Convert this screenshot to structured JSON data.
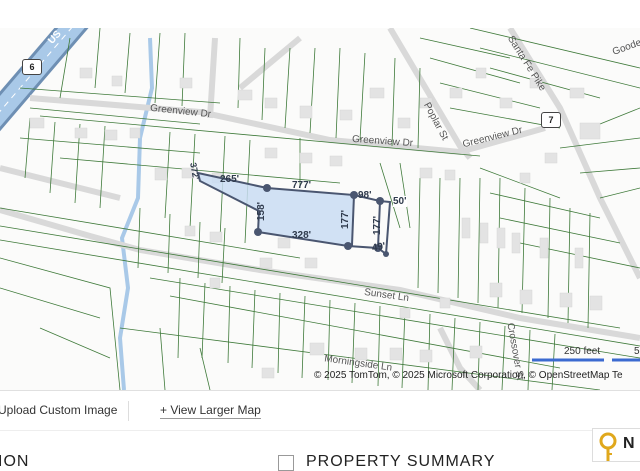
{
  "map": {
    "roads": {
      "greenview_dr_w": "Greenview Dr",
      "greenview_dr_c": "Greenview Dr",
      "greenview_dr_e": "Greenview Dr",
      "poplar_st": "Poplar St",
      "santa_fe_pike": "Santa Fe Pike",
      "sunset_ln": "Sunset Ln",
      "crossover_st": "Crossover St",
      "morningside_ln": "Morningside Ln",
      "goode": "Goode",
      "us_hwy": "US"
    },
    "shields": [
      "6",
      "7"
    ],
    "dimensions": {
      "d372": "372'",
      "d265": "265'",
      "d777": "777'",
      "d98": "98'",
      "d50": "50'",
      "d158": "158'",
      "d328": "328'",
      "d177a": "177'",
      "d177b": "177'",
      "d49": "49'"
    },
    "scale_label_1": "250 feet",
    "scale_label_2": "5",
    "copyright": "© 2025 TomTom, © 2025 Microsoft Corporation, © OpenStreetMap  Te",
    "colors": {
      "parcel_line": "#3f7a3a",
      "highlight_fill": "#c9dcf2",
      "highlight_stroke": "#4a5670",
      "highway": "#9fc0e0",
      "scale_bar": "#3b6ad0"
    }
  },
  "toolbar": {
    "upload_label": "Upload Custom Image",
    "view_larger_label": "+ View Larger Map"
  },
  "bottom": {
    "left_title": "ION",
    "summary_title": "PROPERTY SUMMARY",
    "logo_letter": "N"
  }
}
